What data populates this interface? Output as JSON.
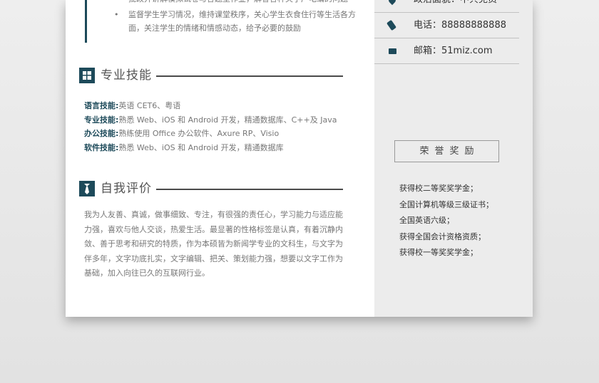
{
  "work": {
    "bullets": [
      "批改并讲解模拟试卷与各题型作业，解答各种关于广电编的问题",
      "监督学生学习情况，维持课堂秩序，关心学生衣食住行等生活各方面，关注学生的情绪和情感动态，给予必要的鼓励"
    ]
  },
  "skills_section": {
    "title": "专业技能",
    "icon": "windows-icon",
    "items": [
      {
        "label": "语言技能:",
        "value": "英语 CET6、粤语"
      },
      {
        "label": "专业技能:",
        "value": "熟悉 Web、iOS 和 Android 开发，精通数据库、C++及 Java"
      },
      {
        "label": "办公技能:",
        "value": "熟练使用 Office 办公软件、Axure RP、Visio"
      },
      {
        "label": "软件技能:",
        "value": "熟悉 Web、iOS 和 Android 开发，精通数据库"
      }
    ]
  },
  "self_eval": {
    "title": "自我评价",
    "icon": "tie-icon",
    "text": "我为人友善、真诚，做事细致、专注，有很强的责任心，学习能力与适应能力强，喜欢与他人交谈，热爱生活。最显著的性格标签是认真，有着沉静内敛、善于思考和研究的特质，作为本硕皆为新闻学专业的文科生，与文字为伴多年，文字功底扎实，文字编辑、把关、策划能力强，想要以文字工作为基础，加入向往已久的互联网行业。"
  },
  "contact": {
    "items": [
      {
        "icon": "location-icon",
        "text": "政治面貌：中共党员"
      },
      {
        "icon": "phone-icon",
        "text": "电话：88888888888"
      },
      {
        "icon": "mail-icon",
        "text": "邮箱：51miz.com"
      }
    ]
  },
  "honors": {
    "title": "荣誉奖励",
    "items": [
      "获得校二等奖奖学金；",
      "全国计算机等级三级证书；",
      "全国英语六级；",
      "获得全国会计资格资质；",
      "获得校一等奖奖学金；"
    ]
  },
  "colors": {
    "accent": "#1d4a5a",
    "sidebar": "#ececec",
    "background": "#e6e6e6"
  }
}
